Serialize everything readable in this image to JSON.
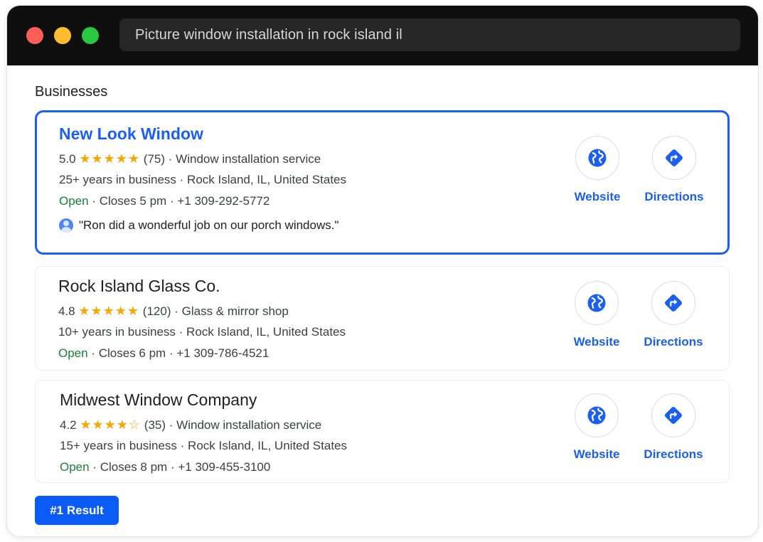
{
  "browser": {
    "search_query": "Picture window installation in rock island il"
  },
  "section_title": "Businesses",
  "businesses": [
    {
      "name": "New Look Window",
      "rating": "5.0",
      "stars": "★★★★★",
      "reviews": "(75)",
      "category": "Window installation service",
      "years": "25+ years in business",
      "location": "Rock Island, IL, United States",
      "status": "Open",
      "closes": "Closes 5 pm",
      "phone": "+1 309-292-5772",
      "review_quote": "\"Ron did a wonderful job on our porch windows.\"",
      "website_label": "Website",
      "directions_label": "Directions"
    },
    {
      "name": "Rock Island Glass Co.",
      "rating": "4.8",
      "stars": "★★★★★",
      "reviews": "(120)",
      "category": "Glass & mirror shop",
      "years": "10+ years in business",
      "location": "Rock Island, IL, United States",
      "status": "Open",
      "closes": "Closes 6 pm",
      "phone": "+1 309-786-4521",
      "website_label": "Website",
      "directions_label": "Directions"
    },
    {
      "name": "Midwest Window Company",
      "rating": "4.2",
      "stars": "★★★★",
      "half_star": "☆",
      "reviews": "(35)",
      "category": "Window installation service",
      "years": "15+ years in business",
      "location": "Rock Island, IL, United States",
      "status": "Open",
      "closes": "Closes 8 pm",
      "phone": "+1 309-455-3100",
      "website_label": "Website",
      "directions_label": "Directions"
    }
  ],
  "separator": "·",
  "badge_label": "#1 Result",
  "colors": {
    "accent": "#1a5ff0",
    "star": "#f6a800",
    "open": "#188038",
    "titlebar": "#0f0f0f"
  },
  "icons": [
    "globe-icon",
    "directions-icon",
    "person-icon"
  ]
}
